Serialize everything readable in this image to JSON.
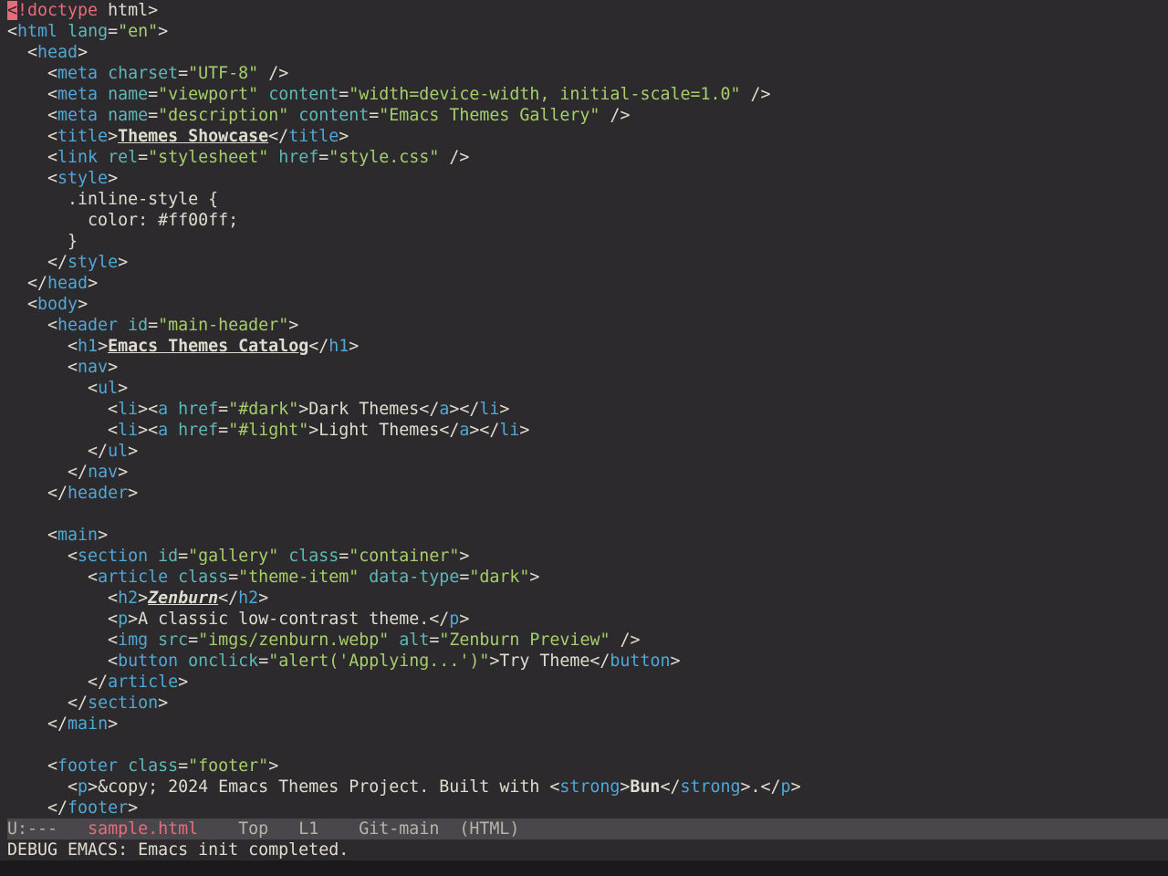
{
  "buffer": {
    "lines": [
      [
        {
          "t": "<",
          "c": "cursor"
        },
        {
          "t": "!doctype",
          "c": "doctype"
        },
        {
          "t": " html>",
          "c": "punct"
        }
      ],
      [
        {
          "t": "<",
          "c": "punct"
        },
        {
          "t": "html",
          "c": "tag"
        },
        {
          "t": " ",
          "c": "punct"
        },
        {
          "t": "lang",
          "c": "attr"
        },
        {
          "t": "=",
          "c": "punct"
        },
        {
          "t": "\"en\"",
          "c": "str"
        },
        {
          "t": ">",
          "c": "punct"
        }
      ],
      [
        {
          "t": "  <",
          "c": "punct"
        },
        {
          "t": "head",
          "c": "tag"
        },
        {
          "t": ">",
          "c": "punct"
        }
      ],
      [
        {
          "t": "    <",
          "c": "punct"
        },
        {
          "t": "meta",
          "c": "tag"
        },
        {
          "t": " ",
          "c": "punct"
        },
        {
          "t": "charset",
          "c": "attr"
        },
        {
          "t": "=",
          "c": "punct"
        },
        {
          "t": "\"UTF-8\"",
          "c": "str"
        },
        {
          "t": " />",
          "c": "punct"
        }
      ],
      [
        {
          "t": "    <",
          "c": "punct"
        },
        {
          "t": "meta",
          "c": "tag"
        },
        {
          "t": " ",
          "c": "punct"
        },
        {
          "t": "name",
          "c": "attr"
        },
        {
          "t": "=",
          "c": "punct"
        },
        {
          "t": "\"viewport\"",
          "c": "str"
        },
        {
          "t": " ",
          "c": "punct"
        },
        {
          "t": "content",
          "c": "attr"
        },
        {
          "t": "=",
          "c": "punct"
        },
        {
          "t": "\"width=device-width, initial-scale=1.0\"",
          "c": "str"
        },
        {
          "t": " />",
          "c": "punct"
        }
      ],
      [
        {
          "t": "    <",
          "c": "punct"
        },
        {
          "t": "meta",
          "c": "tag"
        },
        {
          "t": " ",
          "c": "punct"
        },
        {
          "t": "name",
          "c": "attr"
        },
        {
          "t": "=",
          "c": "punct"
        },
        {
          "t": "\"description\"",
          "c": "str"
        },
        {
          "t": " ",
          "c": "punct"
        },
        {
          "t": "content",
          "c": "attr"
        },
        {
          "t": "=",
          "c": "punct"
        },
        {
          "t": "\"Emacs Themes Gallery\"",
          "c": "str"
        },
        {
          "t": " />",
          "c": "punct"
        }
      ],
      [
        {
          "t": "    <",
          "c": "punct"
        },
        {
          "t": "title",
          "c": "tag"
        },
        {
          "t": ">",
          "c": "punct"
        },
        {
          "t": "Themes Showcase",
          "c": "ul"
        },
        {
          "t": "</",
          "c": "punct"
        },
        {
          "t": "title",
          "c": "tag"
        },
        {
          "t": ">",
          "c": "punct"
        }
      ],
      [
        {
          "t": "    <",
          "c": "punct"
        },
        {
          "t": "link",
          "c": "tag"
        },
        {
          "t": " ",
          "c": "punct"
        },
        {
          "t": "rel",
          "c": "attr"
        },
        {
          "t": "=",
          "c": "punct"
        },
        {
          "t": "\"stylesheet\"",
          "c": "str"
        },
        {
          "t": " ",
          "c": "punct"
        },
        {
          "t": "href",
          "c": "attr"
        },
        {
          "t": "=",
          "c": "punct"
        },
        {
          "t": "\"style.css\"",
          "c": "str"
        },
        {
          "t": " />",
          "c": "punct"
        }
      ],
      [
        {
          "t": "    <",
          "c": "punct"
        },
        {
          "t": "style",
          "c": "tag"
        },
        {
          "t": ">",
          "c": "punct"
        }
      ],
      [
        {
          "t": "      .inline-style {",
          "c": "punct"
        }
      ],
      [
        {
          "t": "        color: #ff00ff;",
          "c": "punct"
        }
      ],
      [
        {
          "t": "      }",
          "c": "punct"
        }
      ],
      [
        {
          "t": "    </",
          "c": "punct"
        },
        {
          "t": "style",
          "c": "tag"
        },
        {
          "t": ">",
          "c": "punct"
        }
      ],
      [
        {
          "t": "  </",
          "c": "punct"
        },
        {
          "t": "head",
          "c": "tag"
        },
        {
          "t": ">",
          "c": "punct"
        }
      ],
      [
        {
          "t": "  <",
          "c": "punct"
        },
        {
          "t": "body",
          "c": "tag"
        },
        {
          "t": ">",
          "c": "punct"
        }
      ],
      [
        {
          "t": "    <",
          "c": "punct"
        },
        {
          "t": "header",
          "c": "tag"
        },
        {
          "t": " ",
          "c": "punct"
        },
        {
          "t": "id",
          "c": "attr"
        },
        {
          "t": "=",
          "c": "punct"
        },
        {
          "t": "\"main-header\"",
          "c": "str"
        },
        {
          "t": ">",
          "c": "punct"
        }
      ],
      [
        {
          "t": "      <",
          "c": "punct"
        },
        {
          "t": "h1",
          "c": "tag"
        },
        {
          "t": ">",
          "c": "punct"
        },
        {
          "t": "Emacs Themes Catalog",
          "c": "ul"
        },
        {
          "t": "</",
          "c": "punct"
        },
        {
          "t": "h1",
          "c": "tag"
        },
        {
          "t": ">",
          "c": "punct"
        }
      ],
      [
        {
          "t": "      <",
          "c": "punct"
        },
        {
          "t": "nav",
          "c": "tag"
        },
        {
          "t": ">",
          "c": "punct"
        }
      ],
      [
        {
          "t": "        <",
          "c": "punct"
        },
        {
          "t": "ul",
          "c": "tag"
        },
        {
          "t": ">",
          "c": "punct"
        }
      ],
      [
        {
          "t": "          <",
          "c": "punct"
        },
        {
          "t": "li",
          "c": "tag"
        },
        {
          "t": "><",
          "c": "punct"
        },
        {
          "t": "a",
          "c": "tag"
        },
        {
          "t": " ",
          "c": "punct"
        },
        {
          "t": "href",
          "c": "attr"
        },
        {
          "t": "=",
          "c": "punct"
        },
        {
          "t": "\"#dark\"",
          "c": "str"
        },
        {
          "t": ">Dark Themes</",
          "c": "punct"
        },
        {
          "t": "a",
          "c": "tag"
        },
        {
          "t": "></",
          "c": "punct"
        },
        {
          "t": "li",
          "c": "tag"
        },
        {
          "t": ">",
          "c": "punct"
        }
      ],
      [
        {
          "t": "          <",
          "c": "punct"
        },
        {
          "t": "li",
          "c": "tag"
        },
        {
          "t": "><",
          "c": "punct"
        },
        {
          "t": "a",
          "c": "tag"
        },
        {
          "t": " ",
          "c": "punct"
        },
        {
          "t": "href",
          "c": "attr"
        },
        {
          "t": "=",
          "c": "punct"
        },
        {
          "t": "\"#light\"",
          "c": "str"
        },
        {
          "t": ">Light Themes</",
          "c": "punct"
        },
        {
          "t": "a",
          "c": "tag"
        },
        {
          "t": "></",
          "c": "punct"
        },
        {
          "t": "li",
          "c": "tag"
        },
        {
          "t": ">",
          "c": "punct"
        }
      ],
      [
        {
          "t": "        </",
          "c": "punct"
        },
        {
          "t": "ul",
          "c": "tag"
        },
        {
          "t": ">",
          "c": "punct"
        }
      ],
      [
        {
          "t": "      </",
          "c": "punct"
        },
        {
          "t": "nav",
          "c": "tag"
        },
        {
          "t": ">",
          "c": "punct"
        }
      ],
      [
        {
          "t": "    </",
          "c": "punct"
        },
        {
          "t": "header",
          "c": "tag"
        },
        {
          "t": ">",
          "c": "punct"
        }
      ],
      [],
      [
        {
          "t": "    <",
          "c": "punct"
        },
        {
          "t": "main",
          "c": "tag"
        },
        {
          "t": ">",
          "c": "punct"
        }
      ],
      [
        {
          "t": "      <",
          "c": "punct"
        },
        {
          "t": "section",
          "c": "tag"
        },
        {
          "t": " ",
          "c": "punct"
        },
        {
          "t": "id",
          "c": "attr"
        },
        {
          "t": "=",
          "c": "punct"
        },
        {
          "t": "\"gallery\"",
          "c": "str"
        },
        {
          "t": " ",
          "c": "punct"
        },
        {
          "t": "class",
          "c": "attr"
        },
        {
          "t": "=",
          "c": "punct"
        },
        {
          "t": "\"container\"",
          "c": "str"
        },
        {
          "t": ">",
          "c": "punct"
        }
      ],
      [
        {
          "t": "        <",
          "c": "punct"
        },
        {
          "t": "article",
          "c": "tag"
        },
        {
          "t": " ",
          "c": "punct"
        },
        {
          "t": "class",
          "c": "attr"
        },
        {
          "t": "=",
          "c": "punct"
        },
        {
          "t": "\"theme-item\"",
          "c": "str"
        },
        {
          "t": " ",
          "c": "punct"
        },
        {
          "t": "data-type",
          "c": "attr"
        },
        {
          "t": "=",
          "c": "punct"
        },
        {
          "t": "\"dark\"",
          "c": "str"
        },
        {
          "t": ">",
          "c": "punct"
        }
      ],
      [
        {
          "t": "          <",
          "c": "punct"
        },
        {
          "t": "h2",
          "c": "tag"
        },
        {
          "t": ">",
          "c": "punct"
        },
        {
          "t": "Zenburn",
          "c": "ul ital"
        },
        {
          "t": "</",
          "c": "punct"
        },
        {
          "t": "h2",
          "c": "tag"
        },
        {
          "t": ">",
          "c": "punct"
        }
      ],
      [
        {
          "t": "          <",
          "c": "punct"
        },
        {
          "t": "p",
          "c": "tag"
        },
        {
          "t": ">A classic low-contrast theme.</",
          "c": "punct"
        },
        {
          "t": "p",
          "c": "tag"
        },
        {
          "t": ">",
          "c": "punct"
        }
      ],
      [
        {
          "t": "          <",
          "c": "punct"
        },
        {
          "t": "img",
          "c": "tag"
        },
        {
          "t": " ",
          "c": "punct"
        },
        {
          "t": "src",
          "c": "attr"
        },
        {
          "t": "=",
          "c": "punct"
        },
        {
          "t": "\"imgs/zenburn.webp\"",
          "c": "str"
        },
        {
          "t": " ",
          "c": "punct"
        },
        {
          "t": "alt",
          "c": "attr"
        },
        {
          "t": "=",
          "c": "punct"
        },
        {
          "t": "\"Zenburn Preview\"",
          "c": "str"
        },
        {
          "t": " />",
          "c": "punct"
        }
      ],
      [
        {
          "t": "          <",
          "c": "punct"
        },
        {
          "t": "button",
          "c": "tag"
        },
        {
          "t": " ",
          "c": "punct"
        },
        {
          "t": "onclick",
          "c": "attr"
        },
        {
          "t": "=",
          "c": "punct"
        },
        {
          "t": "\"alert('Applying...')\"",
          "c": "str"
        },
        {
          "t": ">Try Theme</",
          "c": "punct"
        },
        {
          "t": "button",
          "c": "tag"
        },
        {
          "t": ">",
          "c": "punct"
        }
      ],
      [
        {
          "t": "        </",
          "c": "punct"
        },
        {
          "t": "article",
          "c": "tag"
        },
        {
          "t": ">",
          "c": "punct"
        }
      ],
      [
        {
          "t": "      </",
          "c": "punct"
        },
        {
          "t": "section",
          "c": "tag"
        },
        {
          "t": ">",
          "c": "punct"
        }
      ],
      [
        {
          "t": "    </",
          "c": "punct"
        },
        {
          "t": "main",
          "c": "tag"
        },
        {
          "t": ">",
          "c": "punct"
        }
      ],
      [],
      [
        {
          "t": "    <",
          "c": "punct"
        },
        {
          "t": "footer",
          "c": "tag"
        },
        {
          "t": " ",
          "c": "punct"
        },
        {
          "t": "class",
          "c": "attr"
        },
        {
          "t": "=",
          "c": "punct"
        },
        {
          "t": "\"footer\"",
          "c": "str"
        },
        {
          "t": ">",
          "c": "punct"
        }
      ],
      [
        {
          "t": "      <",
          "c": "punct"
        },
        {
          "t": "p",
          "c": "tag"
        },
        {
          "t": ">&copy; 2024 Emacs Themes Project. Built with <",
          "c": "punct"
        },
        {
          "t": "strong",
          "c": "tag"
        },
        {
          "t": ">",
          "c": "punct"
        },
        {
          "t": "Bun",
          "c": "bold"
        },
        {
          "t": "</",
          "c": "punct"
        },
        {
          "t": "strong",
          "c": "tag"
        },
        {
          "t": ">.</",
          "c": "punct"
        },
        {
          "t": "p",
          "c": "tag"
        },
        {
          "t": ">",
          "c": "punct"
        }
      ],
      [
        {
          "t": "    </",
          "c": "punct"
        },
        {
          "t": "footer",
          "c": "tag"
        },
        {
          "t": ">",
          "c": "punct"
        }
      ]
    ]
  },
  "modeline": {
    "status": "U:---",
    "filename": "sample.html",
    "position": "Top",
    "line": "L1",
    "vc": "Git-main",
    "mode": "(HTML)"
  },
  "minibuffer": {
    "message": "DEBUG EMACS: Emacs init completed."
  },
  "colors": {
    "background": "#2c2a2d",
    "tag": "#4fa8d6",
    "attribute": "#5fb8b8",
    "string": "#a6cf6a",
    "doctype": "#e86b7a",
    "modeline_bg": "#4a474c"
  }
}
